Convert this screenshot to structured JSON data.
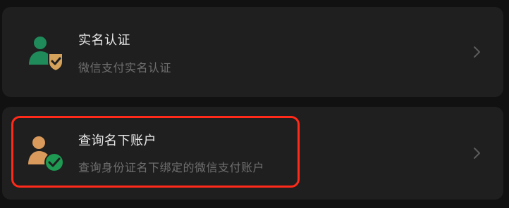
{
  "items": [
    {
      "title": "实名认证",
      "subtitle": "微信支付实名认证",
      "icon": "user-verified-shield-icon"
    },
    {
      "title": "查询名下账户",
      "subtitle": "查询身份证名下绑定的微信支付账户",
      "icon": "user-accounts-check-icon"
    }
  ],
  "colors": {
    "background": "#111111",
    "card": "#1f1f1f",
    "title": "#e8e8e8",
    "subtitle": "#6f6f6f",
    "chevron": "#5c5c5c",
    "highlight": "#ff2a1a",
    "person_green": "#1f8a5a",
    "shield_gold": "#d4a25a",
    "person_orange": "#d99a5c",
    "badge_green": "#1e9a52"
  }
}
